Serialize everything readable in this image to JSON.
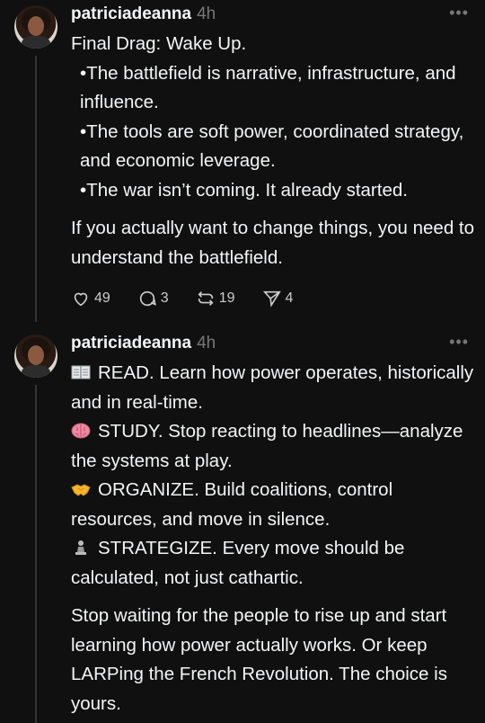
{
  "post1": {
    "username": "patriciadeanna",
    "time": "4h",
    "more": "•••",
    "title_line": "Final Drag: Wake Up.",
    "bullets": [
      "•The battlefield is narrative, infrastructure, and influence.",
      "•The tools are soft power, coordinated strategy, and economic leverage.",
      "•The war isn’t coming. It already started."
    ],
    "closing": "If you actually want to change things, you need to understand the battlefield.",
    "actions": {
      "likes": "49",
      "replies": "3",
      "reposts": "19",
      "shares": "4"
    }
  },
  "post2": {
    "username": "patriciadeanna",
    "time": "4h",
    "more": "•••",
    "items": [
      {
        "icon": "book-emoji",
        "text": "READ. Learn how power operates, historically and in real-time."
      },
      {
        "icon": "brain-emoji",
        "text": "STUDY. Stop reacting to headlines—analyze the systems at play."
      },
      {
        "icon": "handshake-emoji",
        "text": "ORGANIZE. Build coalitions, control resources, and move in silence."
      },
      {
        "icon": "chess-pawn-emoji",
        "text": "STRATEGIZE. Every move should be calculated, not just cathartic."
      }
    ],
    "closing": "Stop waiting for the people to rise up and start learning how power actually works. Or keep LARPing the French Revolution. The choice is yours."
  },
  "colors": {
    "background": "#101010",
    "text": "#f3f5f7",
    "muted": "#777777",
    "thread_line": "#333638"
  }
}
